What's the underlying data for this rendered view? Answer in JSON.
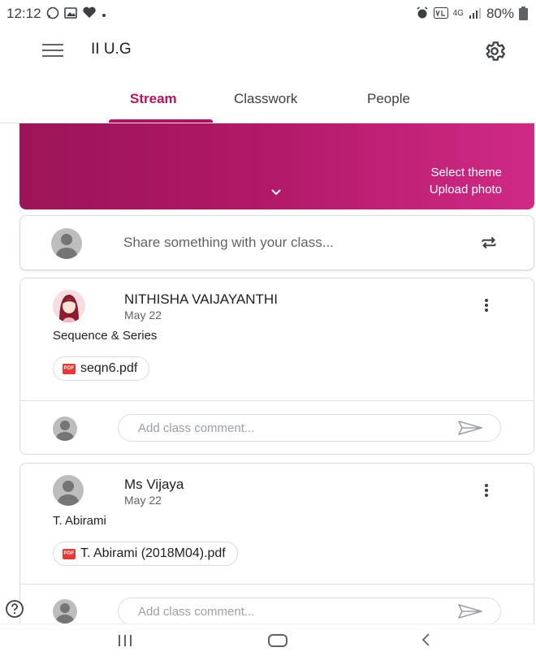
{
  "status_bar": {
    "time": "12:12",
    "network": "4G",
    "battery": "80%",
    "icons": [
      "whatsapp-icon",
      "gallery-icon",
      "heart-icon",
      "dot-icon",
      "alarm-icon",
      "volte-icon",
      "signal-icon",
      "battery-icon"
    ]
  },
  "app_bar": {
    "title": "II U.G"
  },
  "tabs": [
    {
      "label": "Stream",
      "active": true
    },
    {
      "label": "Classwork",
      "active": false
    },
    {
      "label": "People",
      "active": false
    }
  ],
  "banner": {
    "select_theme": "Select theme",
    "upload_photo": "Upload photo"
  },
  "share": {
    "placeholder": "Share something with your class..."
  },
  "posts": [
    {
      "author": "NITHISHA VAIJAYANTHI",
      "date": "May 22",
      "body": "Sequence & Series",
      "attachment": "seqn6.pdf",
      "attachment_type": "PDF",
      "comment_placeholder": "Add class comment..."
    },
    {
      "author": "Ms Vijaya",
      "date": "May 22",
      "body": "T. Abirami",
      "attachment": "T. Abirami (2018M04).pdf",
      "attachment_type": "PDF",
      "comment_placeholder": "Add class comment..."
    }
  ],
  "colors": {
    "accent": "#b0145f",
    "banner_start": "#9b1458",
    "banner_end": "#cf2a86",
    "pdf_red": "#e53935"
  }
}
